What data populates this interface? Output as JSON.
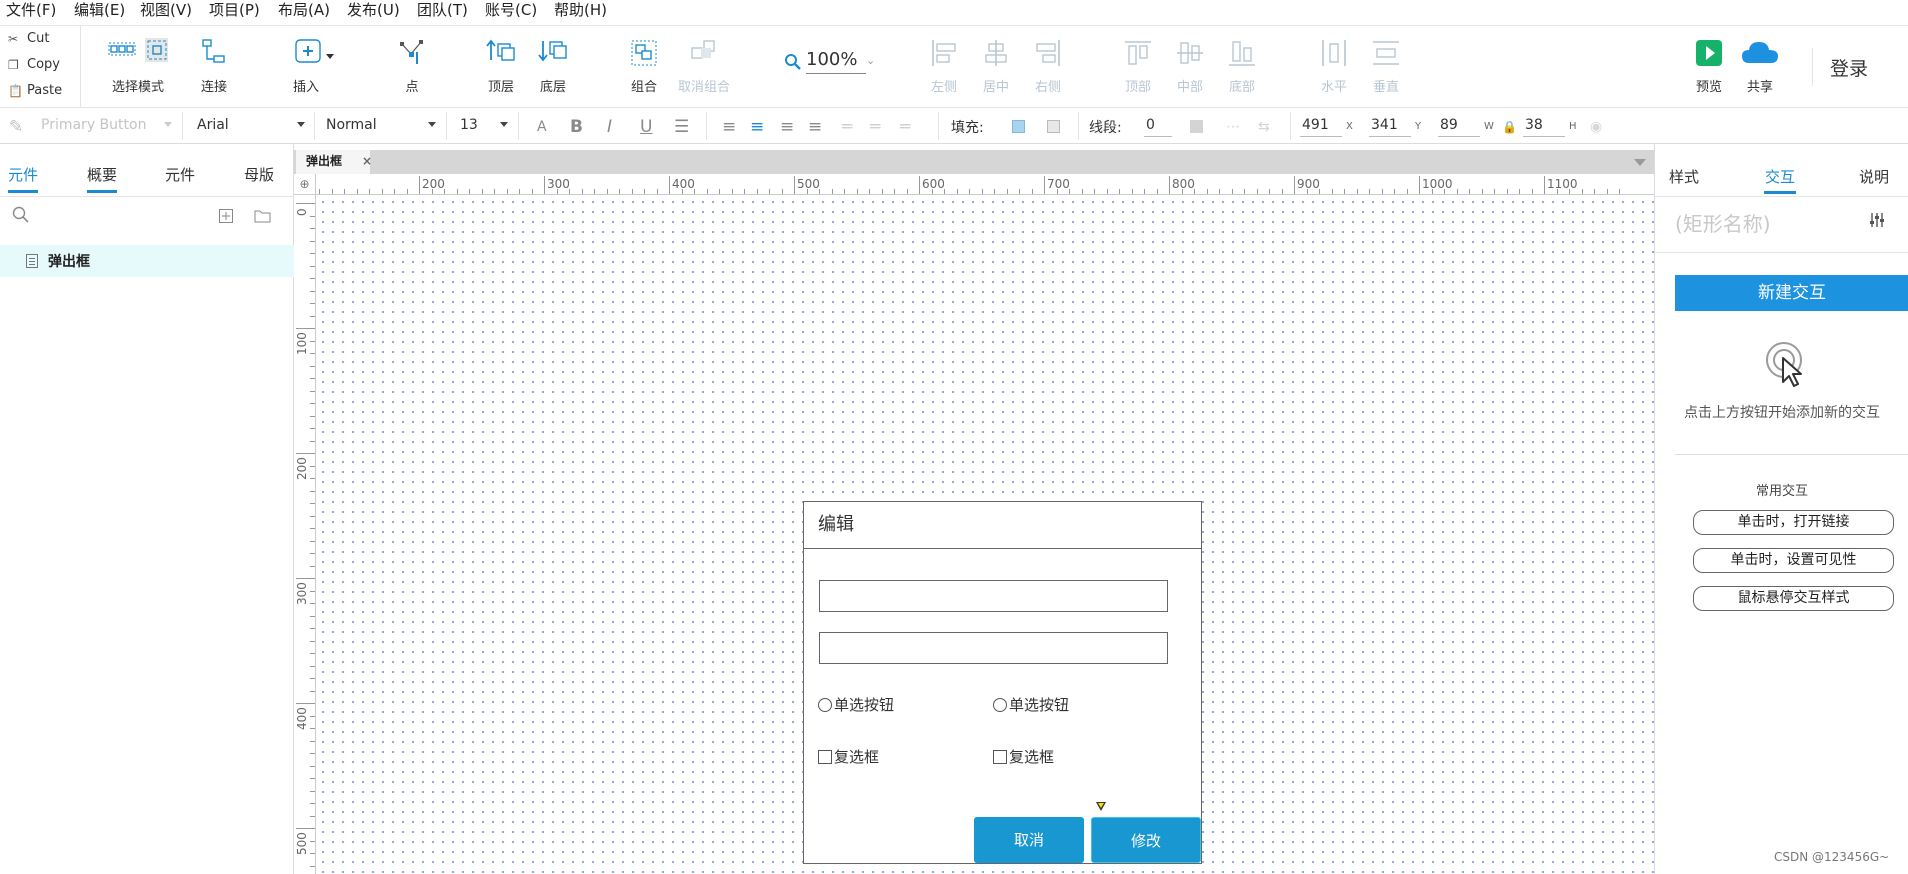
{
  "menu": {
    "items": [
      "文件(F)",
      "编辑(E)",
      "视图(V)",
      "项目(P)",
      "布局(A)",
      "发布(U)",
      "团队(T)",
      "账号(C)",
      "帮助(H)"
    ]
  },
  "toolbar": {
    "clipboard": {
      "cut": "Cut",
      "copy": "Copy",
      "paste": "Paste"
    },
    "select_mode": "选择模式",
    "connect": "连接",
    "insert": "插入",
    "point": "点",
    "bring_front": "顶层",
    "send_back": "底层",
    "group": "组合",
    "ungroup": "取消组合",
    "zoom": "100%",
    "align_left": "左侧",
    "align_center": "居中",
    "align_right": "右侧",
    "align_top": "顶部",
    "align_middle": "中部",
    "align_bottom": "底部",
    "distribute_h": "水平",
    "distribute_v": "垂直",
    "preview": "预览",
    "share": "共享",
    "login": "登录",
    "preview_color": "#17b26a",
    "share_color": "#1e90e0"
  },
  "format": {
    "style": "Primary Button",
    "font": "Arial",
    "weight": "Normal",
    "size": "13",
    "fill_label": "填充:",
    "stroke_label": "线段:",
    "stroke_width": "0",
    "x": "491",
    "x_unit": "X",
    "y": "341",
    "y_unit": "Y",
    "w": "89",
    "w_unit": "W",
    "h": "38",
    "h_unit": "H",
    "fill_color": "#a8d4f0"
  },
  "left_panel": {
    "tabs": [
      "元件",
      "概要",
      "元件",
      "母版"
    ],
    "active_tab": 0,
    "pages": [
      "弹出框"
    ]
  },
  "canvas": {
    "tab": "弹出框",
    "ruler_h": [
      "200",
      "300",
      "400",
      "500",
      "600",
      "700",
      "800",
      "900",
      "1000",
      "1100"
    ],
    "ruler_v": [
      "0",
      "100",
      "200",
      "300",
      "400",
      "500"
    ]
  },
  "dialog": {
    "title": "编辑",
    "radios": [
      "单选按钮",
      "单选按钮"
    ],
    "checkboxes": [
      "复选框",
      "复选框"
    ],
    "cancel": "取消",
    "confirm": "修改",
    "button_color": "#1897d0"
  },
  "right_panel": {
    "tabs": [
      "样式",
      "交互",
      "说明"
    ],
    "active_tab": 1,
    "shape_name": "(矩形名称)",
    "new_interaction": "新建交互",
    "hint": "点击上方按钮开始添加新的交互",
    "common_title": "常用交互",
    "common": [
      "单击时，打开链接",
      "单击时，设置可见性",
      "鼠标悬停交互样式"
    ],
    "accent": "#1a8bd0"
  },
  "watermark": "CSDN @123456G~"
}
